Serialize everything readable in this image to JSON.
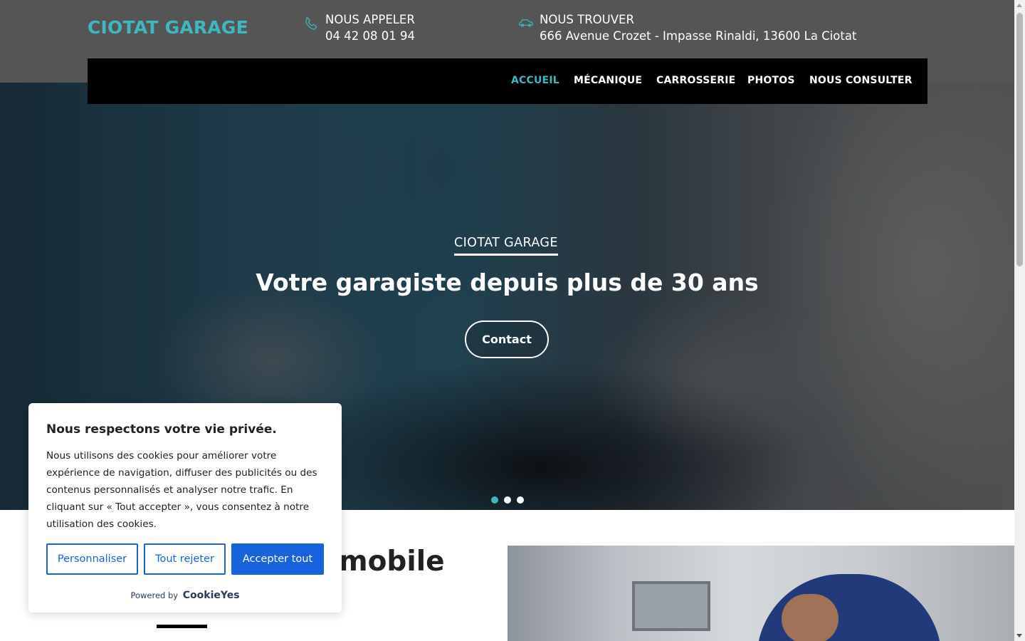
{
  "brand": {
    "name": "CIOTAT GARAGE",
    "color": "#3fb6c0"
  },
  "contact": {
    "call_label": "NOUS APPELER",
    "call_value": "04 42 08 01 94",
    "find_label": "NOUS TROUVER",
    "find_value": "666 Avenue Crozet - Impasse Rinaldi, 13600 La Ciotat",
    "call_icon": "phone-icon",
    "find_icon": "car-icon"
  },
  "nav": {
    "items": [
      {
        "label": "ACCUEIL",
        "active": true
      },
      {
        "label": "MÉCANIQUE",
        "active": false
      },
      {
        "label": "CARROSSERIE",
        "active": false
      },
      {
        "label": "PHOTOS",
        "active": false
      },
      {
        "label": "NOUS CONSULTER",
        "active": false
      }
    ]
  },
  "hero": {
    "kicker": "CIOTAT GARAGE",
    "title": "Votre garagiste depuis plus de 30 ans",
    "button": "Contact",
    "slides": 3,
    "active_slide": 1
  },
  "section": {
    "heading_visible": "mobile"
  },
  "cookie_banner": {
    "title": "Nous respectons votre vie privée.",
    "text": "Nous utilisons des cookies pour améliorer votre expérience de navigation, diffuser des publicités ou des contenus personnalisés et analyser notre trafic. En cliquant sur « Tout accepter », vous consentez à notre utilisation des cookies.",
    "customize": "Personnaliser",
    "reject": "Tout rejeter",
    "accept": "Accepter tout",
    "powered_by": "Powered by",
    "powered_brand": "CookieYes",
    "accent": "#1863dc"
  },
  "colors": {
    "topbar": "#555555",
    "navbar": "#000000",
    "accent": "#3fb6c0"
  }
}
